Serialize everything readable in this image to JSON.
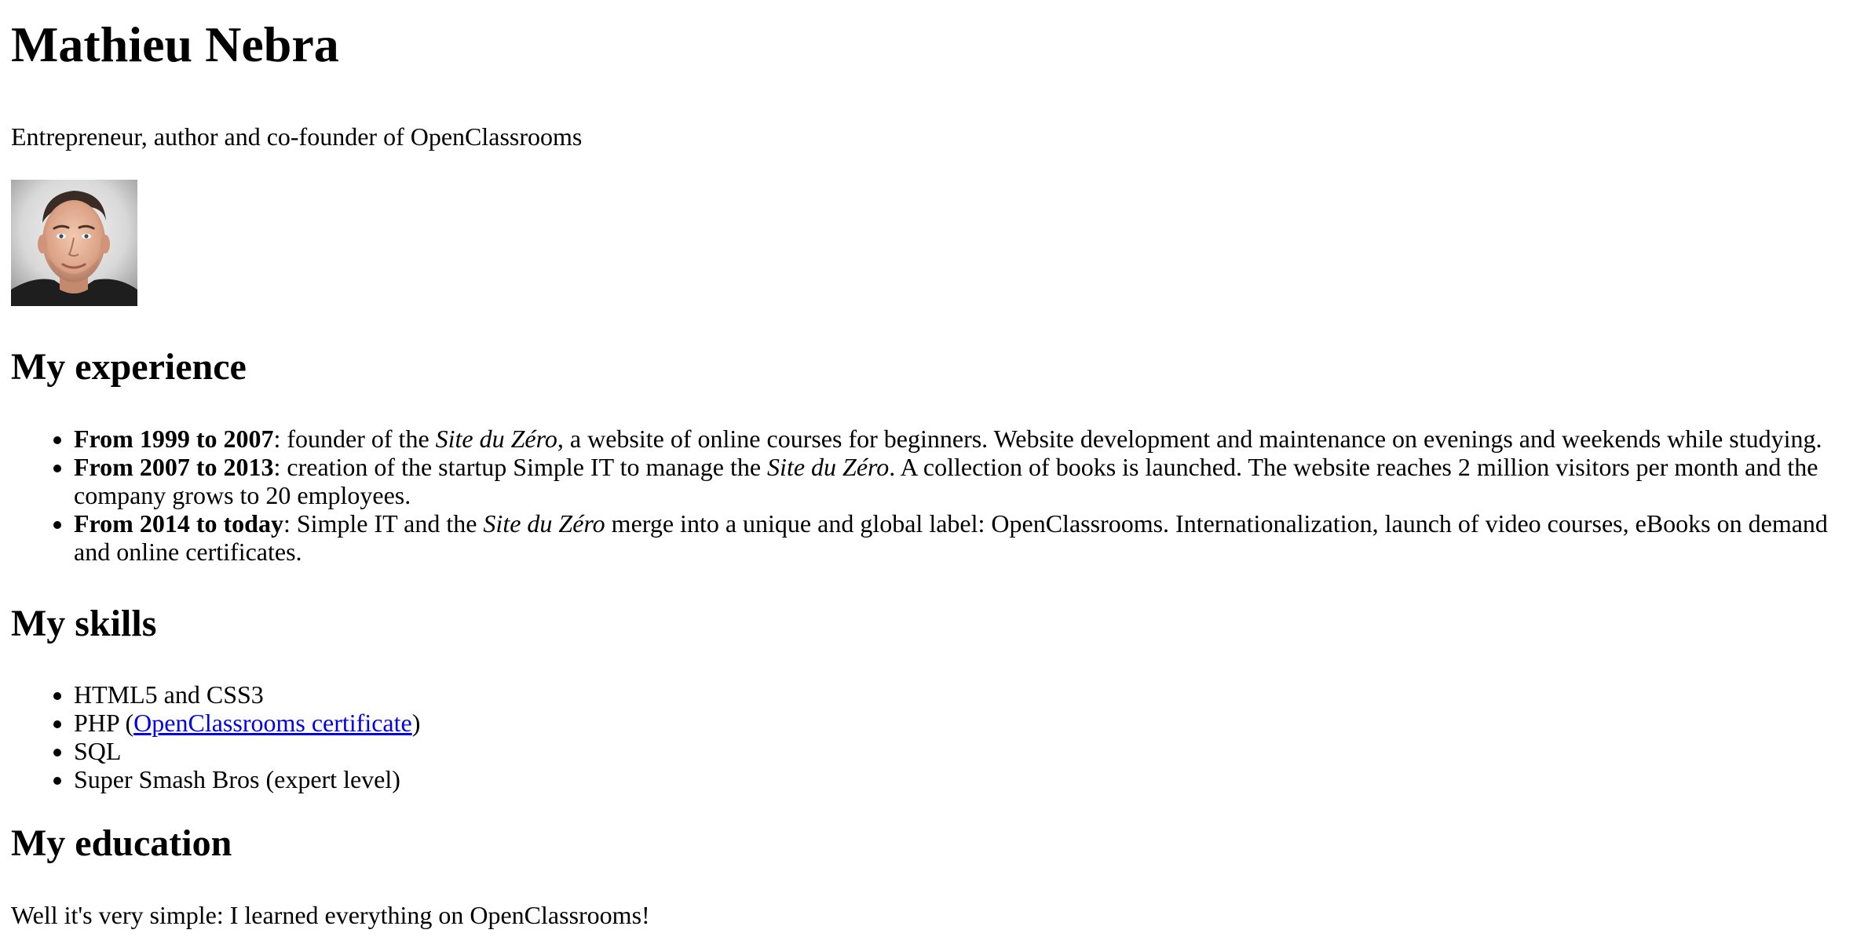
{
  "header": {
    "name": "Mathieu Nebra",
    "tagline": "Entrepreneur, author and co-founder of OpenClassrooms"
  },
  "photo": {
    "alt": "Photo of Mathieu Nebra"
  },
  "experience": {
    "title": "My experience",
    "items": [
      {
        "period": "From 1999 to 2007",
        "before": ": founder of the ",
        "site": "Site du Zéro",
        "after": ", a website of online courses for beginners. Website development and maintenance on evenings and weekends while studying."
      },
      {
        "period": "From 2007 to 2013",
        "before": ": creation of the startup Simple IT to manage the ",
        "site": "Site du Zéro",
        "after": ". A collection of books is launched. The website reaches 2 million visitors per month and the company grows to 20 employees."
      },
      {
        "period": "From 2014 to today",
        "before": ": Simple IT and the ",
        "site": "Site du Zéro",
        "after": " merge into a unique and global label: OpenClassrooms. Internationalization, launch of video courses, eBooks on demand and online certificates."
      }
    ]
  },
  "skills": {
    "title": "My skills",
    "item1": "HTML5 and CSS3",
    "item2_before": "PHP (",
    "item2_link": "OpenClassrooms certificate",
    "item2_after": ")",
    "item3": "SQL",
    "item4": "Super Smash Bros (expert level)"
  },
  "education": {
    "title": "My education",
    "text": "Well it's very simple: I learned everything on OpenClassrooms!"
  },
  "colors": {
    "link": "#0000ee",
    "text": "#000000",
    "background": "#ffffff"
  }
}
